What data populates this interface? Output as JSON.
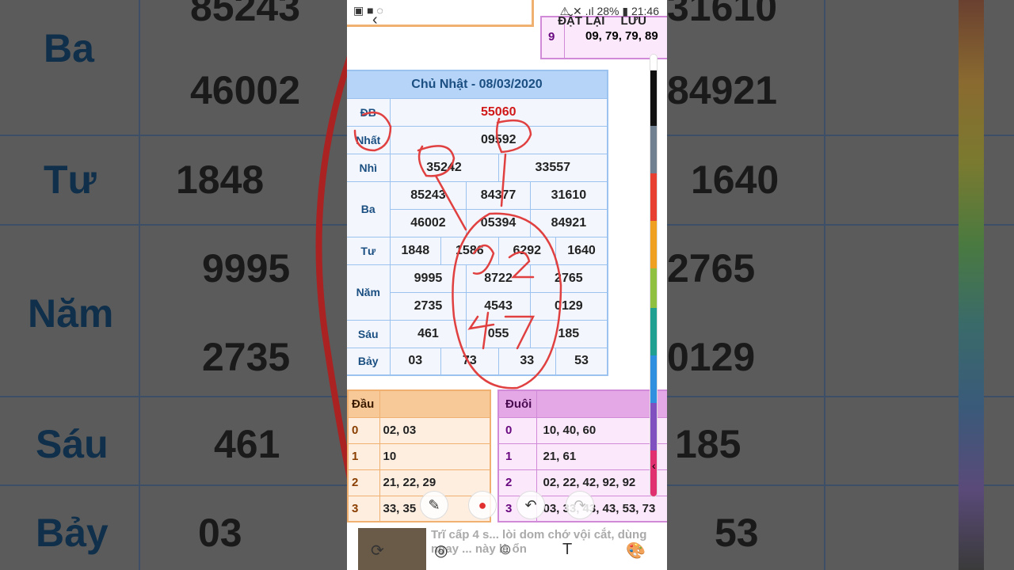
{
  "background": {
    "left": [
      {
        "label": "Ba",
        "value": "46002",
        "top_value": "85243"
      },
      {
        "label": "Tư",
        "value": "1848"
      },
      {
        "label": "Năm",
        "values": [
          "9995",
          "2735"
        ]
      },
      {
        "label": "Sáu",
        "value": "461"
      },
      {
        "label": "Bảy",
        "value": "03"
      }
    ],
    "right": [
      "31610",
      "84921",
      "1640",
      "2765",
      "0129",
      "185",
      "53"
    ]
  },
  "status_bar": {
    "battery": "28%",
    "time": "21:46"
  },
  "top_actions": {
    "reset": "ĐẶT LẠI",
    "save": "LƯU"
  },
  "prev_table": {
    "key": "9",
    "value": "09, 79, 79, 89"
  },
  "results": {
    "title": "Chủ Nhật - 08/03/2020",
    "rows": [
      {
        "label": "ĐB",
        "values": [
          "55060"
        ]
      },
      {
        "label": "Nhất",
        "values": [
          "09592"
        ]
      },
      {
        "label": "Nhì",
        "values": [
          "35242",
          "33557"
        ]
      },
      {
        "label": "Ba",
        "values": [
          "85243",
          "84377",
          "31610",
          "46002",
          "05394",
          "84921"
        ]
      },
      {
        "label": "Tư",
        "values": [
          "1848",
          "1586",
          "6292",
          "1640"
        ]
      },
      {
        "label": "Năm",
        "values": [
          "9995",
          "8722",
          "2765",
          "2735",
          "4543",
          "0129"
        ]
      },
      {
        "label": "Sáu",
        "values": [
          "461",
          "055",
          "185"
        ]
      },
      {
        "label": "Bảy",
        "values": [
          "03",
          "73",
          "33",
          "53"
        ]
      }
    ]
  },
  "dau": {
    "header": "Đầu",
    "rows": [
      {
        "k": "0",
        "v": "02, 03"
      },
      {
        "k": "1",
        "v": "10"
      },
      {
        "k": "2",
        "v": "21, 22, 29"
      },
      {
        "k": "3",
        "v": "33, 35"
      }
    ]
  },
  "duoi": {
    "header": "Đuôi",
    "rows": [
      {
        "k": "0",
        "v": "10, 40, 60"
      },
      {
        "k": "1",
        "v": "21, 61"
      },
      {
        "k": "2",
        "v": "02, 22, 42, 92, 92"
      },
      {
        "k": "3",
        "v": "03, 33, 43, 43, 53, 73"
      }
    ]
  },
  "ad": {
    "text": "Trĩ cấp 4 s... lòi dom chớ vội cắt, dùng ngay ... này là ổn"
  },
  "colors": {
    "accent_red": "#d01818",
    "result_blue": "#b6d4f8",
    "dau_orange": "#f8c998",
    "duoi_purple": "#e4a8e6"
  }
}
